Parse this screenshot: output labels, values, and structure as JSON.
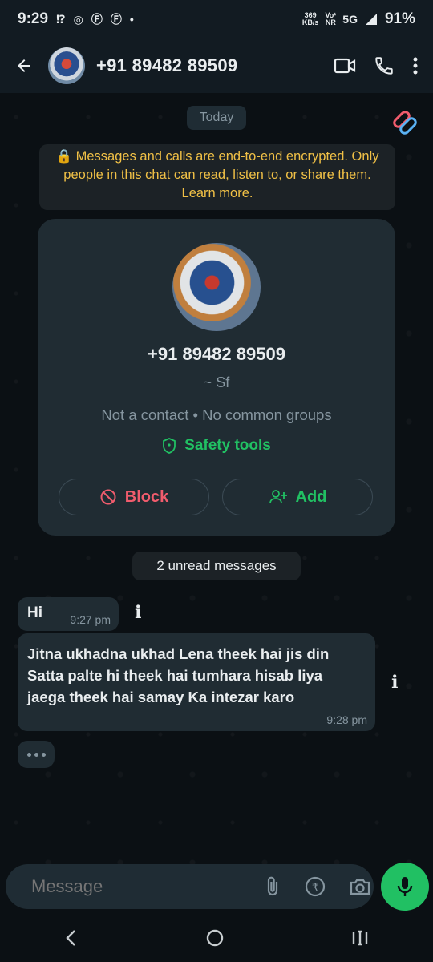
{
  "status_bar": {
    "time": "9:29",
    "net_speed": "369",
    "net_speed_unit": "KB/s",
    "volte": "Vo¹",
    "nr": "NR",
    "network": "5G",
    "battery": "91%"
  },
  "header": {
    "title": "+91 89482 89509"
  },
  "chat": {
    "date_label": "Today",
    "encryption_notice": "🔒 Messages and calls are end-to-end encrypted. Only people in this chat can read, listen to, or share them. Learn more.",
    "contact_card": {
      "phone": "+91 89482 89509",
      "name": "~ Sf",
      "meta": "Not a contact • No common groups",
      "safety_label": "Safety tools",
      "block_label": "Block",
      "add_label": "Add"
    },
    "unread_label": "2 unread messages",
    "messages": [
      {
        "text": "Hi",
        "time": "9:27 pm"
      },
      {
        "text": "Jitna ukhadna ukhad Lena theek hai jis din Satta palte hi theek hai tumhara hisab liya jaega theek hai samay Ka intezar karo",
        "time": "9:28 pm"
      }
    ]
  },
  "composer": {
    "placeholder": "Message"
  },
  "colors": {
    "accent": "#21c063",
    "danger": "#f15c6d",
    "notice": "#f0c046",
    "bubble": "#202c33"
  }
}
